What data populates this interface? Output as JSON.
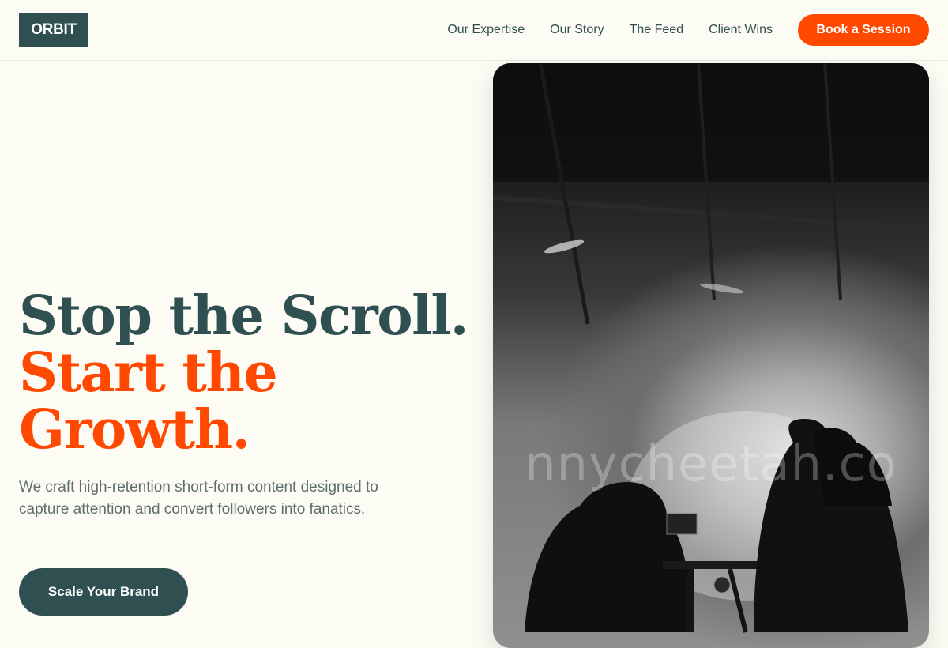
{
  "header": {
    "logo": "ORBIT",
    "nav": [
      "Our Expertise",
      "Our Story",
      "The Feed",
      "Client Wins"
    ],
    "cta": "Book a Session"
  },
  "hero": {
    "title_line1": "Stop the Scroll.",
    "title_line2": "Start the",
    "title_line3": "Growth.",
    "subtitle": "We craft high-retention short-form content designed to capture attention and convert followers into fanatics.",
    "cta": "Scale Your Brand"
  },
  "image": {
    "watermark": "nnycheetah.co",
    "description_icon": "film-crew-photo"
  },
  "colors": {
    "brand_dark": "#2f4f50",
    "accent": "#ff4800",
    "background": "#fcfbf4",
    "body_text": "#5f6f6f"
  }
}
